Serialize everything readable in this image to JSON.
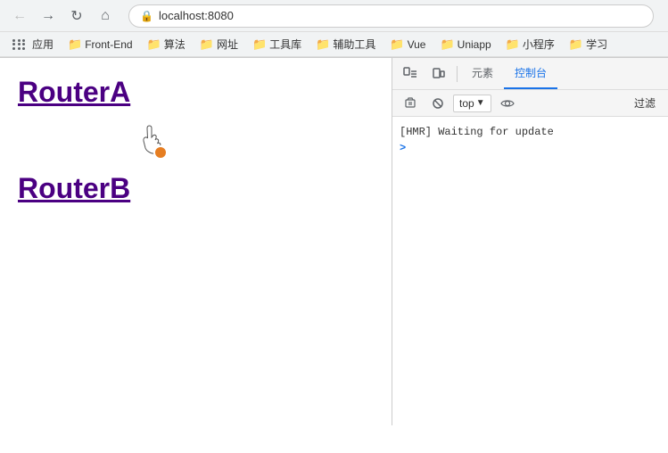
{
  "browser": {
    "url": "localhost:8080",
    "back_button": "←",
    "forward_button": "→",
    "reload_button": "↺",
    "home_button": "⌂"
  },
  "bookmarks": [
    {
      "label": "应用",
      "type": "apps"
    },
    {
      "label": "Front-End",
      "type": "folder"
    },
    {
      "label": "算法",
      "type": "folder"
    },
    {
      "label": "网址",
      "type": "folder"
    },
    {
      "label": "工具库",
      "type": "folder"
    },
    {
      "label": "辅助工具",
      "type": "folder"
    },
    {
      "label": "Vue",
      "type": "folder"
    },
    {
      "label": "Uniapp",
      "type": "folder"
    },
    {
      "label": "小程序",
      "type": "folder"
    },
    {
      "label": "学习",
      "type": "folder"
    }
  ],
  "page": {
    "router_a_label": "RouterA",
    "router_b_label": "RouterB"
  },
  "devtools": {
    "tabs": [
      {
        "label": "元素",
        "active": false
      },
      {
        "label": "控制台",
        "active": true
      }
    ],
    "toolbar": {
      "top_label": "top",
      "filter_label": "过滤"
    },
    "console_messages": [
      {
        "text": "[HMR] Waiting for update"
      }
    ],
    "prompt_symbol": ">"
  }
}
